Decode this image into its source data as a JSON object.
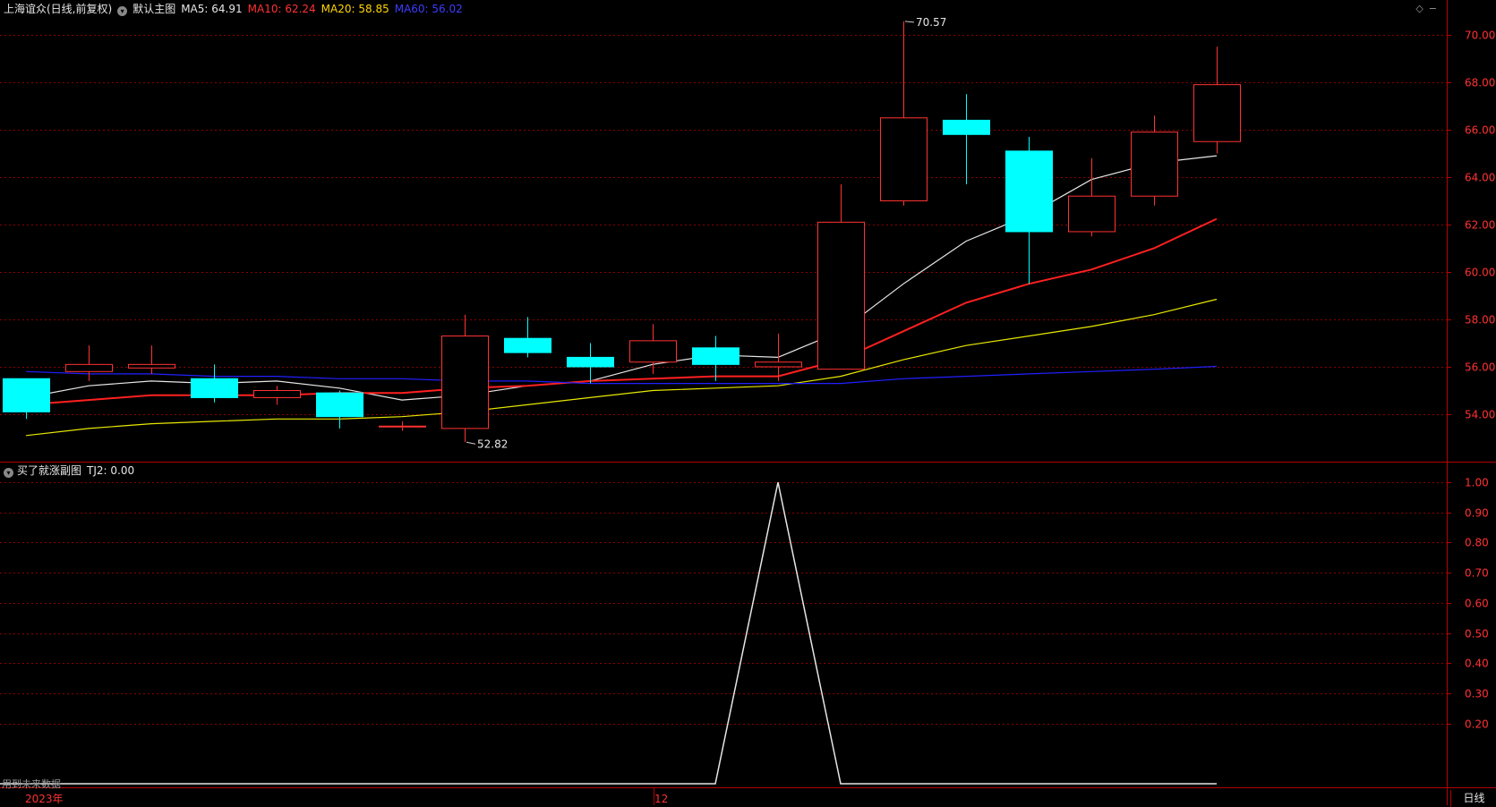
{
  "header": {
    "stock_name": "上海谊众(日线,前复权)",
    "main_label": "默认主图",
    "ma5_label": "MA5: 64.91",
    "ma10_label": "MA10: 62.24",
    "ma20_label": "MA20: 58.85",
    "ma60_label": "MA60: 56.02"
  },
  "sub_header": {
    "indicator_name": "买了就涨副图",
    "tj2_label": "TJ2: 0.00"
  },
  "footer": {
    "future_notice": "用到未来数据",
    "year_label": "2023年",
    "month_label": "12",
    "period_label": "日线"
  },
  "colors": {
    "up": "#ff3232",
    "down": "#00ffff",
    "ma5": "#e6e6e6",
    "ma10": "#ff2020",
    "ma20": "#e8e800",
    "ma60": "#2020ff",
    "grid": "#8b0000",
    "axis": "#b40000"
  },
  "chart_data": [
    {
      "type": "candlestick",
      "ylim": [
        52.0,
        71.0
      ],
      "yticks": [
        54.0,
        56.0,
        58.0,
        60.0,
        62.0,
        64.0,
        66.0,
        68.0,
        70.0
      ],
      "annotations": [
        {
          "text": "70.57",
          "index": 14,
          "value": 70.57
        },
        {
          "text": "52.82",
          "index": 7,
          "value": 52.82
        }
      ],
      "candles": [
        {
          "open": 55.5,
          "high": 55.5,
          "low": 53.8,
          "close": 54.1
        },
        {
          "open": 55.8,
          "high": 56.9,
          "low": 55.4,
          "close": 56.1
        },
        {
          "open": 55.95,
          "high": 56.9,
          "low": 55.7,
          "close": 56.1
        },
        {
          "open": 55.5,
          "high": 56.1,
          "low": 54.5,
          "close": 54.7
        },
        {
          "open": 54.7,
          "high": 55.2,
          "low": 54.4,
          "close": 55.0
        },
        {
          "open": 54.9,
          "high": 55.0,
          "low": 53.4,
          "close": 53.9
        },
        {
          "open": 53.5,
          "high": 53.7,
          "low": 53.3,
          "close": 53.5
        },
        {
          "open": 53.4,
          "high": 58.2,
          "low": 52.82,
          "close": 57.3
        },
        {
          "open": 57.2,
          "high": 58.1,
          "low": 56.4,
          "close": 56.6
        },
        {
          "open": 56.4,
          "high": 57.0,
          "low": 55.3,
          "close": 56.0
        },
        {
          "open": 56.2,
          "high": 57.8,
          "low": 55.7,
          "close": 57.1
        },
        {
          "open": 56.8,
          "high": 57.3,
          "low": 55.4,
          "close": 56.1
        },
        {
          "open": 56.0,
          "high": 57.4,
          "low": 55.4,
          "close": 56.2
        },
        {
          "open": 55.9,
          "high": 63.7,
          "low": 55.9,
          "close": 62.1
        },
        {
          "open": 63.0,
          "high": 70.57,
          "low": 62.8,
          "close": 66.5
        },
        {
          "open": 66.4,
          "high": 67.5,
          "low": 63.7,
          "close": 65.8
        },
        {
          "open": 65.1,
          "high": 65.7,
          "low": 59.5,
          "close": 61.7
        },
        {
          "open": 61.7,
          "high": 64.8,
          "low": 61.5,
          "close": 63.2
        },
        {
          "open": 63.2,
          "high": 66.6,
          "low": 62.8,
          "close": 65.9
        },
        {
          "open": 65.5,
          "high": 69.5,
          "low": 65.0,
          "close": 67.9
        }
      ],
      "series": [
        {
          "name": "MA5",
          "values": [
            54.7,
            55.2,
            55.4,
            55.3,
            55.4,
            55.1,
            54.6,
            54.8,
            55.2,
            55.4,
            56.1,
            56.5,
            56.4,
            57.5,
            59.5,
            61.3,
            62.4,
            63.9,
            64.6,
            64.9
          ]
        },
        {
          "name": "MA10",
          "values": [
            54.4,
            54.6,
            54.8,
            54.8,
            54.8,
            54.9,
            54.9,
            55.1,
            55.2,
            55.4,
            55.5,
            55.6,
            55.6,
            56.3,
            57.5,
            58.7,
            59.5,
            60.1,
            61.0,
            62.24
          ]
        },
        {
          "name": "MA20",
          "values": [
            53.1,
            53.4,
            53.6,
            53.7,
            53.8,
            53.8,
            53.9,
            54.1,
            54.4,
            54.7,
            55.0,
            55.1,
            55.2,
            55.6,
            56.3,
            56.9,
            57.3,
            57.7,
            58.2,
            58.85
          ]
        },
        {
          "name": "MA60",
          "values": [
            55.8,
            55.7,
            55.7,
            55.6,
            55.6,
            55.5,
            55.5,
            55.4,
            55.4,
            55.3,
            55.3,
            55.3,
            55.3,
            55.3,
            55.5,
            55.6,
            55.7,
            55.8,
            55.9,
            56.02
          ]
        }
      ]
    },
    {
      "type": "line",
      "ylim": [
        0.0,
        1.0
      ],
      "yticks": [
        0.2,
        0.3,
        0.4,
        0.5,
        0.6,
        0.7,
        0.8,
        0.9,
        1.0
      ],
      "series": [
        {
          "name": "TJ2",
          "values": [
            0,
            0,
            0,
            0,
            0,
            0,
            0,
            0,
            0,
            0,
            0,
            0,
            1,
            0,
            0,
            0,
            0,
            0,
            0,
            0
          ]
        }
      ]
    }
  ]
}
